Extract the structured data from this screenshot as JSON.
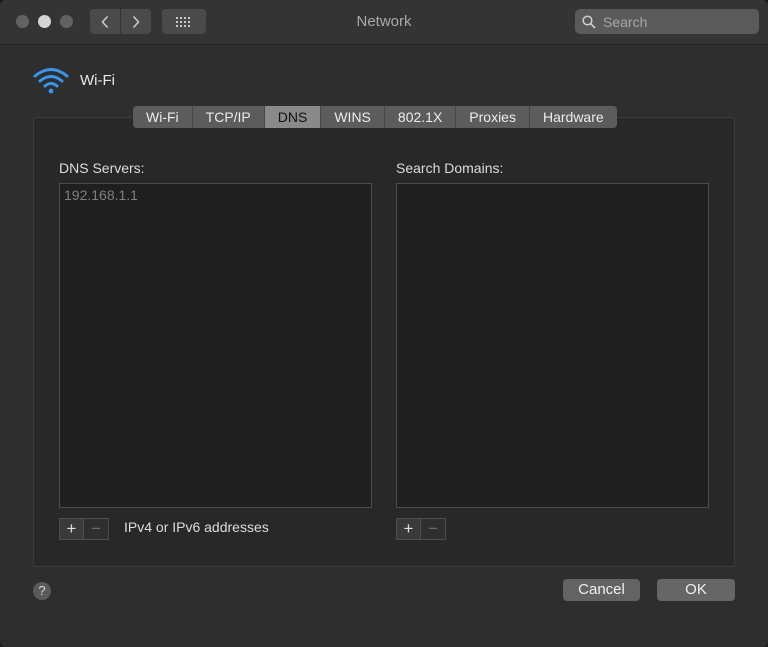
{
  "window": {
    "title": "Network"
  },
  "search": {
    "placeholder": "Search"
  },
  "service": {
    "name": "Wi-Fi"
  },
  "tabs": [
    {
      "label": "Wi-Fi",
      "active": false
    },
    {
      "label": "TCP/IP",
      "active": false
    },
    {
      "label": "DNS",
      "active": true
    },
    {
      "label": "WINS",
      "active": false
    },
    {
      "label": "802.1X",
      "active": false
    },
    {
      "label": "Proxies",
      "active": false
    },
    {
      "label": "Hardware",
      "active": false
    }
  ],
  "dns": {
    "label": "DNS Servers:",
    "servers": [
      "192.168.1.1"
    ],
    "hint": "IPv4 or IPv6 addresses"
  },
  "domains": {
    "label": "Search Domains:",
    "items": []
  },
  "controls": {
    "add": "+",
    "remove": "−"
  },
  "footer": {
    "help": "?",
    "cancel": "Cancel",
    "ok": "OK"
  },
  "colors": {
    "accent": "#2f8ff5",
    "active_tab": "#8a8a8a"
  }
}
